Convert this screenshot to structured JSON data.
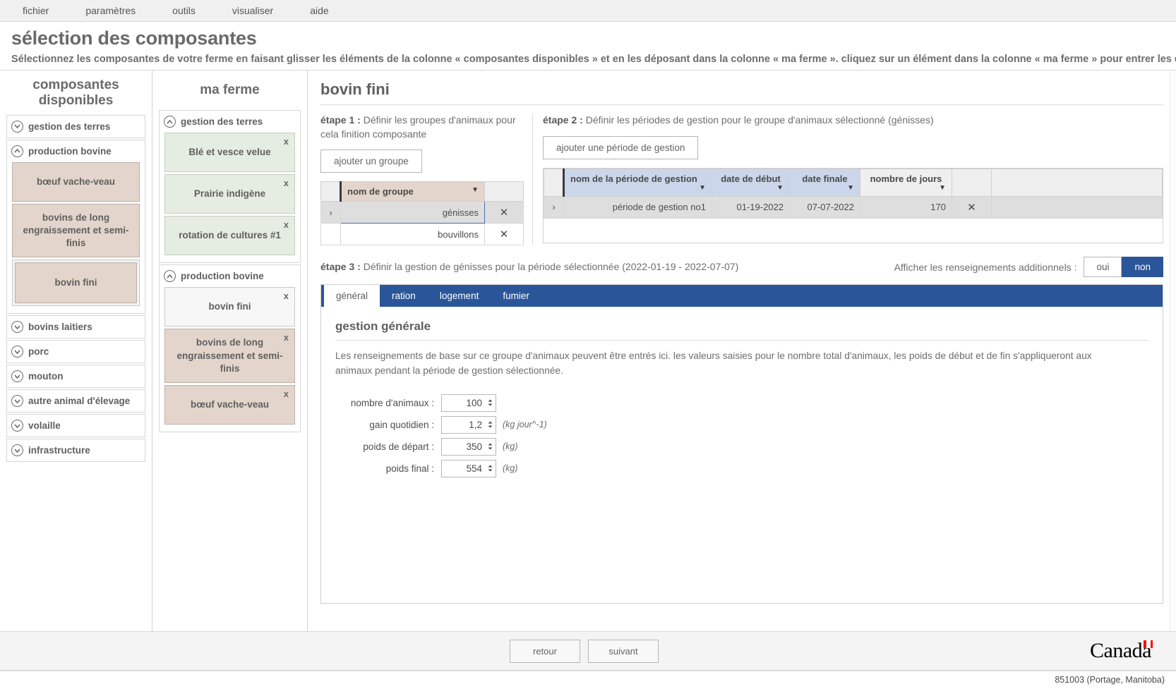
{
  "menubar": {
    "items": [
      {
        "label": "fichier"
      },
      {
        "label": "paramètres"
      },
      {
        "label": "outils"
      },
      {
        "label": "visualiser"
      },
      {
        "label": "aide"
      }
    ]
  },
  "header": {
    "title": "sélection des composantes",
    "subtitle": "Sélectionnez les composantes de votre ferme en faisant glisser les éléments de la colonne « composantes disponibles » et en les déposant dans la colonne « ma ferme ». cliquez sur un élément dans la colonne « ma ferme » pour entrer les détails."
  },
  "available": {
    "heading": "composantes\ndisponibles",
    "groups": [
      {
        "label": "gestion des terres",
        "expanded": false,
        "items": []
      },
      {
        "label": "production bovine",
        "expanded": true,
        "items": [
          {
            "label": "bœuf vache-veau",
            "selected": false
          },
          {
            "label": "bovins de long engraissement et semi-finis",
            "selected": false
          },
          {
            "label": "bovin fini",
            "selected": true
          }
        ]
      },
      {
        "label": "bovins laitiers",
        "expanded": false,
        "items": []
      },
      {
        "label": "porc",
        "expanded": false,
        "items": []
      },
      {
        "label": "mouton",
        "expanded": false,
        "items": []
      },
      {
        "label": "autre animal d'élevage",
        "expanded": false,
        "items": []
      },
      {
        "label": "volaille",
        "expanded": false,
        "items": []
      },
      {
        "label": "infrastructure",
        "expanded": false,
        "items": []
      }
    ]
  },
  "myfarm": {
    "heading": "ma ferme",
    "groups": [
      {
        "label": "gestion des terres",
        "expanded": true,
        "items": [
          {
            "label": "Blé et vesce velue",
            "remove": "x",
            "kind": "green"
          },
          {
            "label": "Prairie indigène",
            "remove": "x",
            "kind": "green"
          },
          {
            "label": "rotation de cultures #1",
            "remove": "x",
            "kind": "green"
          }
        ]
      },
      {
        "label": "production bovine",
        "expanded": true,
        "items": [
          {
            "label": "bovin fini",
            "remove": "x",
            "kind": "white"
          },
          {
            "label": "bovins de long engraissement et semi-finis",
            "remove": "x",
            "kind": "brown"
          },
          {
            "label": "bœuf vache-veau",
            "remove": "x",
            "kind": "brown"
          }
        ]
      }
    ]
  },
  "detail": {
    "title": "bovin fini",
    "step1": {
      "prefix": "étape 1 :",
      "text": " Définir les groupes d'animaux pour cela finition composante",
      "add_button": "ajouter un groupe",
      "columns": [
        "",
        "nom de groupe",
        ""
      ],
      "rows": [
        {
          "expander": "›",
          "name": "génisses",
          "remove": "✕",
          "selected": true
        },
        {
          "expander": "",
          "name": "bouvillons",
          "remove": "✕",
          "selected": false
        }
      ]
    },
    "step2": {
      "prefix": "étape 2 :",
      "text": " Définir les périodes de gestion pour le groupe d'animaux sélectionné (génisses)",
      "add_button": "ajouter une période de gestion",
      "columns": [
        "",
        "nom de la période de gestion",
        "date de début",
        "date finale",
        "nombre de jours",
        "",
        ""
      ],
      "rows": [
        {
          "expander": "›",
          "name": "période de gestion no1",
          "start": "01-19-2022",
          "end": "07-07-2022",
          "days": "170",
          "remove": "✕"
        }
      ]
    },
    "step3": {
      "prefix": "étape 3 :",
      "text": " Définir la gestion de génisses pour la période sélectionnée (2022-01-19 - 2022-07-07)",
      "additional_label": "Afficher les renseignements additionnels :",
      "toggle": {
        "yes": "oui",
        "no": "non",
        "selected": "non"
      },
      "tabs": [
        {
          "label": "général",
          "active": true
        },
        {
          "label": "ration",
          "active": false
        },
        {
          "label": "logement",
          "active": false
        },
        {
          "label": "fumier",
          "active": false
        }
      ],
      "panel": {
        "heading": "gestion générale",
        "description": "Les renseignements de base sur ce groupe d'animaux peuvent être entrés ici. les valeurs saisies pour le nombre total d'animaux, les poids de début et de fin s'appliqueront aux animaux pendant la période de gestion sélectionnée.",
        "fields": [
          {
            "label": "nombre d'animaux :",
            "value": "100",
            "unit": ""
          },
          {
            "label": "gain quotidien :",
            "value": "1,2",
            "unit": "(kg jour^-1)"
          },
          {
            "label": "poids de départ :",
            "value": "350",
            "unit": "(kg)"
          },
          {
            "label": "poids final :",
            "value": "554",
            "unit": "(kg)"
          }
        ]
      }
    }
  },
  "footer": {
    "back": "retour",
    "next": "suivant",
    "wordmark": "Canada",
    "status": "851003 (Portage, Manitoba)"
  },
  "colors": {
    "accent": "#2a5699",
    "brown_card": "#e3d5cb",
    "green_card": "#e5ece2",
    "header_blue": "#ccd6ea"
  }
}
